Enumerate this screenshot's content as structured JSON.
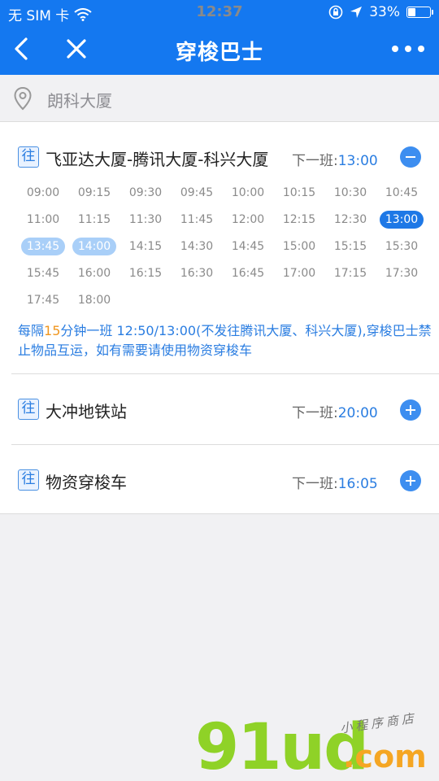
{
  "status": {
    "carrier": "无 SIM 卡",
    "time": "12:37",
    "battery": "33%"
  },
  "nav": {
    "title": "穿梭巴士"
  },
  "location": {
    "name": "朗科大厦"
  },
  "routes": [
    {
      "tag": "往",
      "name": "飞亚达大厦-腾讯大厦-科兴大厦",
      "next_label": "下一班:",
      "next_time": "13:00",
      "times": [
        "09:00",
        "09:15",
        "09:30",
        "09:45",
        "10:00",
        "10:15",
        "10:30",
        "10:45",
        "11:00",
        "11:15",
        "11:30",
        "11:45",
        "12:00",
        "12:15",
        "12:30",
        "13:00",
        "13:45",
        "14:00",
        "14:15",
        "14:30",
        "14:45",
        "15:00",
        "15:15",
        "15:30",
        "15:45",
        "16:00",
        "16:15",
        "16:30",
        "16:45",
        "17:00",
        "17:15",
        "17:30",
        "17:45",
        "18:00"
      ],
      "highlight_current": "13:00",
      "highlight_past": [
        "13:45",
        "14:00"
      ],
      "note_prefix": "每隔",
      "note_interval": "15",
      "note_rest": "分钟一班 12:50/13:00(不发往腾讯大厦、科兴大厦),穿梭巴士禁止物品互运，如有需要请使用物资穿梭车"
    },
    {
      "tag": "往",
      "name": "大冲地铁站",
      "next_label": "下一班:",
      "next_time": "20:00"
    },
    {
      "tag": "往",
      "name": "物资穿梭车",
      "next_label": "下一班:",
      "next_time": "16:05"
    }
  ],
  "watermark": {
    "brand": "91ud",
    "suffix": ".com",
    "tagline": "小程序商店"
  },
  "colors": {
    "primary": "#1478f0",
    "link": "#2a7de1",
    "accent_orange": "#f0961e",
    "brand_green": "#8ad11d"
  }
}
